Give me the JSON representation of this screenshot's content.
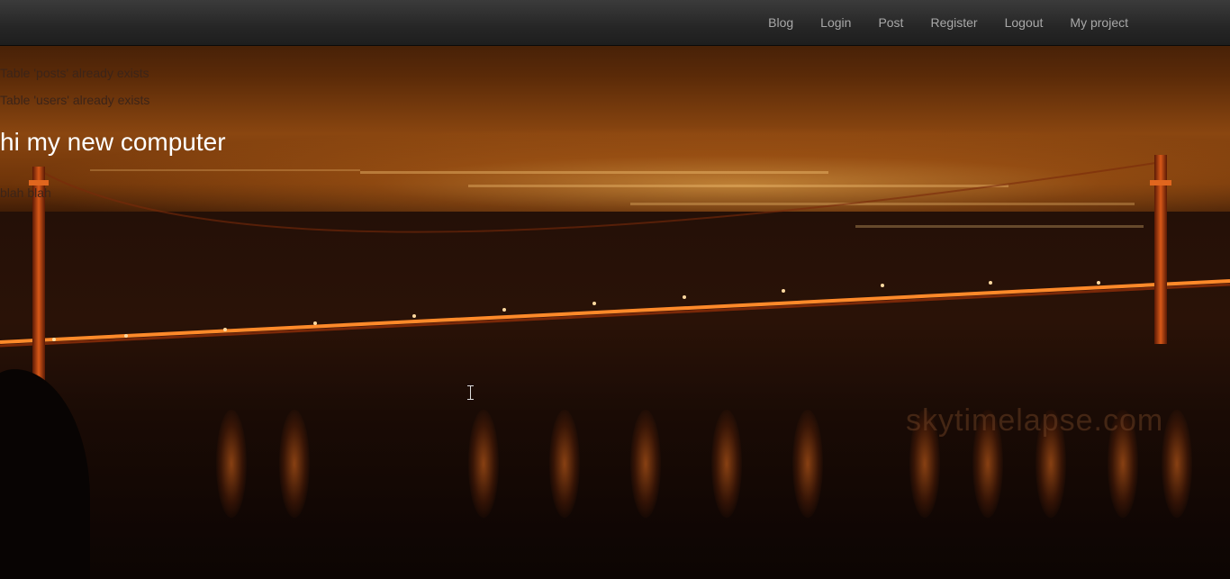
{
  "nav": {
    "links": [
      {
        "label": "Blog"
      },
      {
        "label": "Login"
      },
      {
        "label": "Post"
      },
      {
        "label": "Register"
      },
      {
        "label": "Logout"
      },
      {
        "label": "My project"
      }
    ]
  },
  "messages": [
    "Table 'posts' already exists",
    "Table 'users' already exists"
  ],
  "post": {
    "title": "hi my new computer",
    "body": "blah blah"
  },
  "background": {
    "watermark": "skytimelapse.com"
  }
}
